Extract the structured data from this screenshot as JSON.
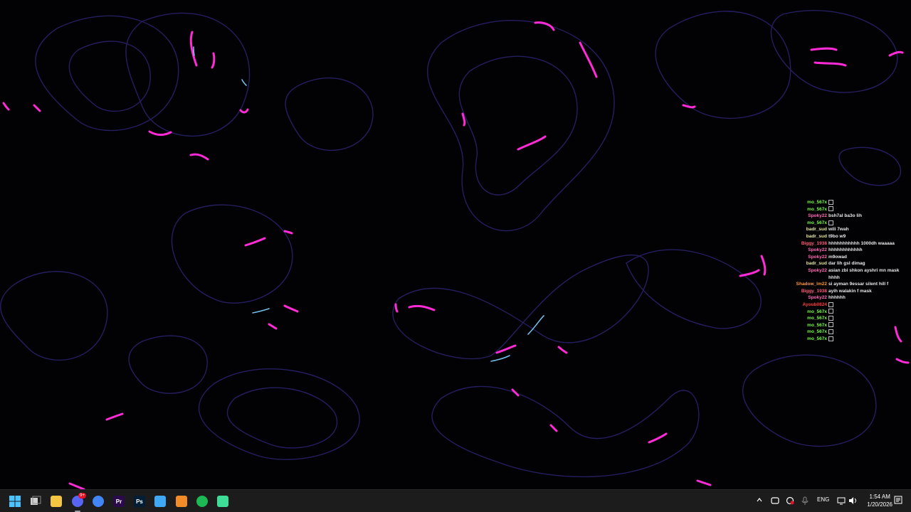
{
  "chat": {
    "messages": [
      {
        "user": "mo_567x",
        "color": "#7cfc52",
        "text": "",
        "emote": true
      },
      {
        "user": "mo_567x",
        "color": "#7cfc52",
        "text": "",
        "emote": true
      },
      {
        "user": "Spoky22",
        "color": "#ff69b4",
        "text": "bsh7al ba3o lih",
        "emote": false
      },
      {
        "user": "mo_567x",
        "color": "#7cfc52",
        "text": "",
        "emote": true
      },
      {
        "user": "badr_sud",
        "color": "#e8e8a0",
        "text": "wili 7wah",
        "emote": false
      },
      {
        "user": "badr_sud",
        "color": "#e8e8a0",
        "text": "t9bo w9",
        "emote": false
      },
      {
        "user": "Biggy_1938",
        "color": "#ff5a7a",
        "text": "hhhhhhhhhhh 1000dh waaaaa",
        "emote": false
      },
      {
        "user": "Spoky22",
        "color": "#ff69b4",
        "text": "hhhhhhhhhhhh",
        "emote": false
      },
      {
        "user": "Spoky22",
        "color": "#ff69b4",
        "text": "m9owad",
        "emote": false
      },
      {
        "user": "badr_sud",
        "color": "#e8e8a0",
        "text": "dar lih gsl dimag",
        "emote": false
      },
      {
        "user": "Spoky22",
        "color": "#ff69b4",
        "text": "asian zbi shkon ayshri mn mask hhhh",
        "emote": false
      },
      {
        "user": "Shadow_lm22",
        "color": "#ff9a3c",
        "text": "si ayman 9essar silent hill f",
        "emote": false
      },
      {
        "user": "Biggy_1938",
        "color": "#ff5a7a",
        "text": "ayih walakin f mask",
        "emote": false
      },
      {
        "user": "Spoky22",
        "color": "#ff69b4",
        "text": "hhhhhh",
        "emote": false
      },
      {
        "user": "Ayoub0824",
        "color": "#ff3b3b",
        "text": "",
        "emote": true
      },
      {
        "user": "mo_567x",
        "color": "#7cfc52",
        "text": "",
        "emote": true
      },
      {
        "user": "mo_567x",
        "color": "#7cfc52",
        "text": "",
        "emote": true
      },
      {
        "user": "mo_567x",
        "color": "#7cfc52",
        "text": "",
        "emote": true
      },
      {
        "user": "mo_567x",
        "color": "#7cfc52",
        "text": "",
        "emote": true
      },
      {
        "user": "mo_567x",
        "color": "#7cfc52",
        "text": "",
        "emote": true
      }
    ]
  },
  "taskbar": {
    "apps": [
      {
        "name": "start-button",
        "icon": "windows-icon",
        "color": "#4cc2ff"
      },
      {
        "name": "task-view-button",
        "icon": "task-view-icon",
        "color": "#cfcfcf"
      },
      {
        "name": "file-explorer-button",
        "icon": "folder-icon",
        "color": "#f4c542"
      },
      {
        "name": "discord-button",
        "icon": "discord-icon",
        "color": "#5865f2",
        "badge": "9+"
      },
      {
        "name": "chrome-button",
        "icon": "chrome-icon",
        "color": "#4285f4"
      },
      {
        "name": "premiere-button",
        "icon": "premiere-icon",
        "color": "#2a0a4a",
        "label": "Pr"
      },
      {
        "name": "photoshop-button",
        "icon": "photoshop-icon",
        "color": "#001e36",
        "label": "Ps"
      },
      {
        "name": "notepad-button",
        "icon": "notepad-icon",
        "color": "#3fa9f5"
      },
      {
        "name": "app-a-button",
        "icon": "app-a-icon",
        "color": "#f28c28"
      },
      {
        "name": "spotify-button",
        "icon": "spotify-icon",
        "color": "#1db954"
      },
      {
        "name": "bot-app-button",
        "icon": "bot-icon",
        "color": "#3ddc97"
      }
    ],
    "tray": {
      "language": "ENG",
      "time": "1:54 AM",
      "date": "1/20/2026"
    }
  },
  "colors": {
    "accent_magenta": "#ff2bd6",
    "contour": "#3b2f8f"
  }
}
